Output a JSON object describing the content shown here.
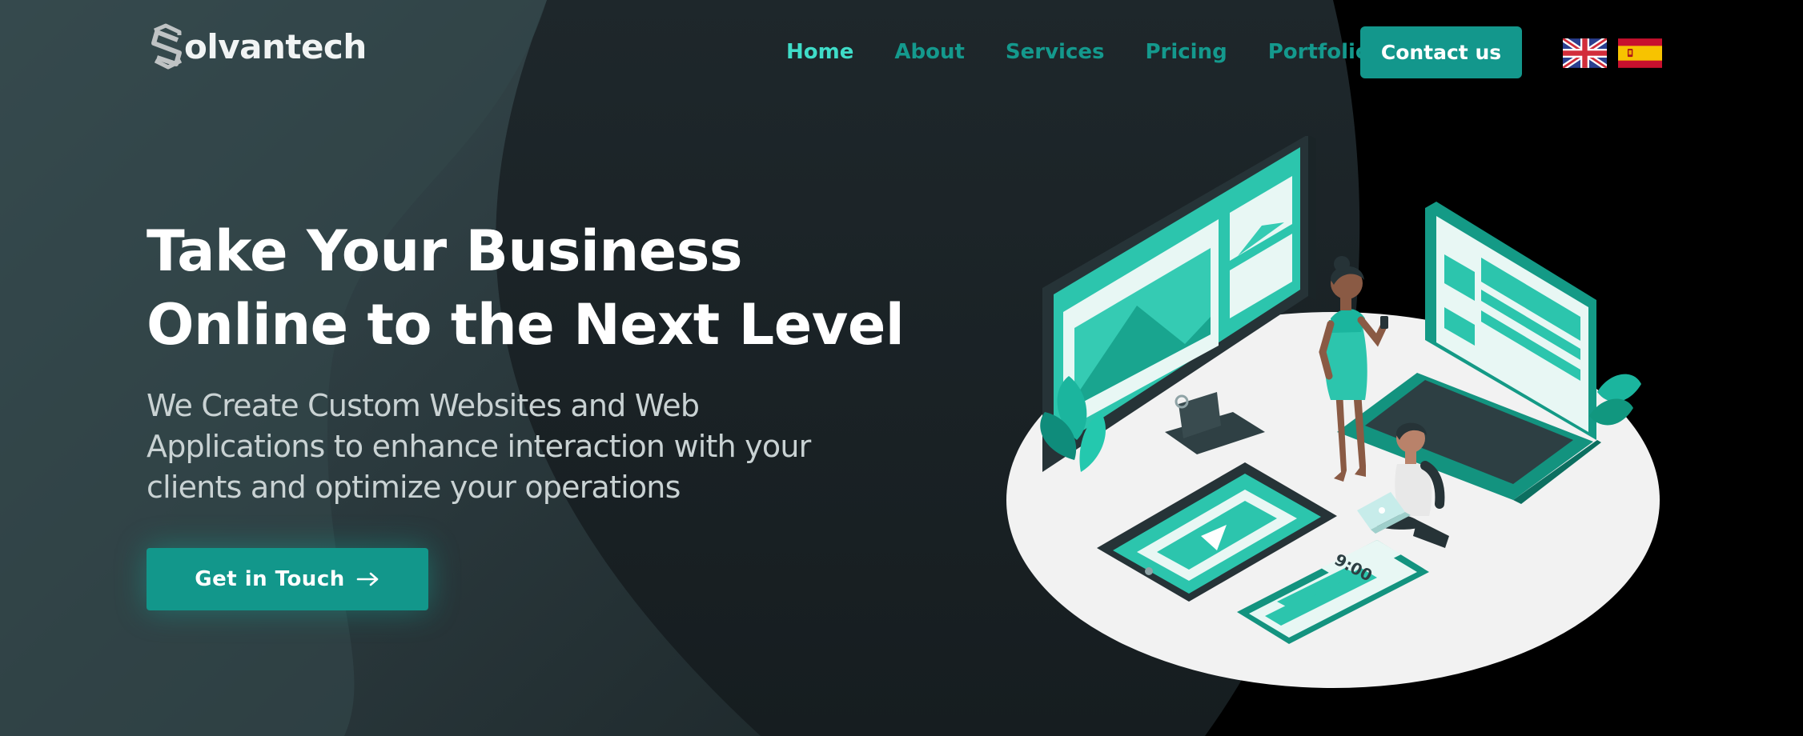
{
  "brand": {
    "logo_letter": "S",
    "name_rest": "olvantech",
    "logo_color": "#bfc3c4"
  },
  "nav": {
    "items": [
      {
        "label": "Home",
        "active": true
      },
      {
        "label": "About",
        "active": false
      },
      {
        "label": "Services",
        "active": false
      },
      {
        "label": "Pricing",
        "active": false
      },
      {
        "label": "Portfolio",
        "active": false
      }
    ],
    "contact_label": "Contact us"
  },
  "languages": [
    {
      "icon": "uk-flag-icon",
      "code": "en"
    },
    {
      "icon": "spain-flag-icon",
      "code": "es"
    }
  ],
  "hero": {
    "title_lines": [
      "Take Your Business",
      "Online to the Next Level"
    ],
    "subtitle_lines": [
      "We Create Custom Websites and Web",
      "Applications to enhance interaction with your",
      "clients and optimize your operations"
    ],
    "cta_label": "Get in Touch",
    "cta_icon": "arrow-right-icon"
  },
  "illustration": {
    "phone_time": "9:00",
    "icons": [
      "desktop-monitor-icon",
      "laptop-icon",
      "tablet-icon",
      "smartphone-icon",
      "play-icon",
      "woman-figure",
      "man-figure",
      "plant-icon"
    ]
  },
  "colors": {
    "accent": "#13978c",
    "nav_text": "#14998d",
    "nav_active": "#3fdcc8",
    "background_dark": "#1a2225",
    "background_panel": "#324448",
    "text_white": "#ffffff",
    "subtitle_text": "#c9d2d3"
  }
}
